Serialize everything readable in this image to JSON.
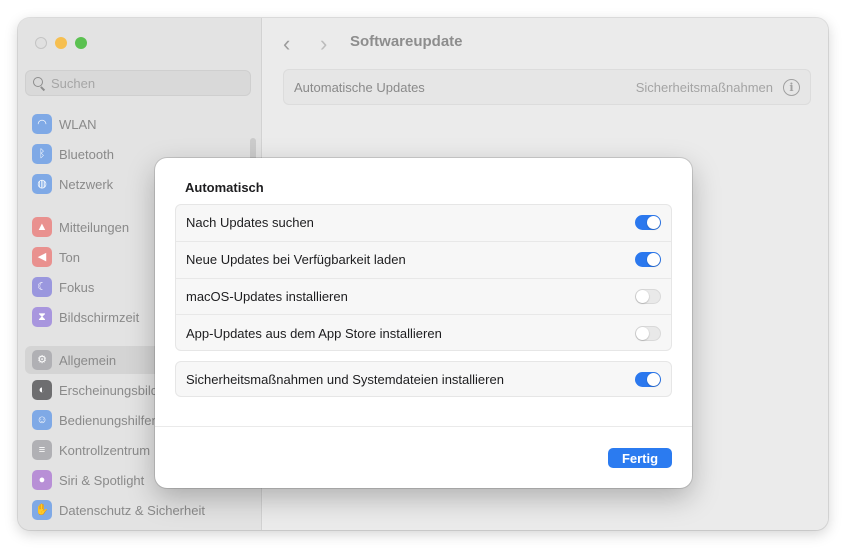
{
  "sidebar": {
    "search_placeholder": "Suchen",
    "items": [
      {
        "label": "WLAN",
        "icon": "wifi-icon",
        "color": "#3b8ef0"
      },
      {
        "label": "Bluetooth",
        "icon": "bluetooth-icon",
        "color": "#3b8ef0"
      },
      {
        "label": "Netzwerk",
        "icon": "globe-icon",
        "color": "#3b8ef0"
      },
      {
        "label": "Mitteilungen",
        "icon": "bell-icon",
        "color": "#ef5a57"
      },
      {
        "label": "Ton",
        "icon": "speaker-icon",
        "color": "#ef5a57"
      },
      {
        "label": "Fokus",
        "icon": "moon-icon",
        "color": "#5e5ce6"
      },
      {
        "label": "Bildschirmzeit",
        "icon": "hourglass-icon",
        "color": "#7d5ce6"
      },
      {
        "label": "Allgemein",
        "icon": "gear-icon",
        "color": "#8e8e93"
      },
      {
        "label": "Erscheinungsbild",
        "icon": "appearance-icon",
        "color": "#1d1d1f"
      },
      {
        "label": "Bedienungshilfen",
        "icon": "accessibility-icon",
        "color": "#3b8ef0"
      },
      {
        "label": "Kontrollzentrum",
        "icon": "control-center-icon",
        "color": "#8e8e93"
      },
      {
        "label": "Siri & Spotlight",
        "icon": "siri-icon",
        "color": "#b05ce6"
      },
      {
        "label": "Datenschutz & Sicherheit",
        "icon": "hand-icon",
        "color": "#3b8ef0"
      }
    ]
  },
  "main": {
    "title": "Softwareupdate",
    "row_label": "Automatische Updates",
    "row_value": "Sicherheitsmaßnahmen"
  },
  "dialog": {
    "title": "Automatisch",
    "options": [
      {
        "label": "Nach Updates suchen",
        "on": true
      },
      {
        "label": "Neue Updates bei Verfügbarkeit laden",
        "on": true
      },
      {
        "label": "macOS-Updates installieren",
        "on": false
      },
      {
        "label": "App-Updates aus dem App Store installieren",
        "on": false
      }
    ],
    "security_option": {
      "label": "Sicherheitsmaßnahmen und Systemdateien installieren",
      "on": true
    },
    "done_label": "Fertig"
  }
}
